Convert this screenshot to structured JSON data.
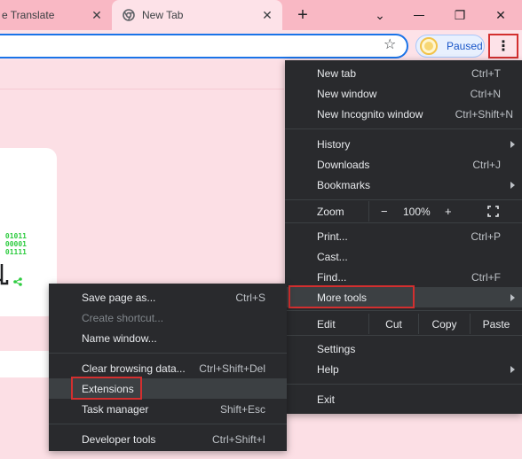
{
  "tabs": [
    {
      "title": "e Translate",
      "close": "✕",
      "icon": "translate-icon"
    },
    {
      "title": "New Tab",
      "close": "✕",
      "icon": "chrome-icon"
    }
  ],
  "new_tab_button": "+",
  "window_controls": {
    "dropdown": "⌄",
    "restore": "❐",
    "close": "✕"
  },
  "toolbar": {
    "bookmark_icon": "☆",
    "profile_label": "Paused",
    "menu_icon": "⋮"
  },
  "page": {
    "binary_lines": [
      "01011",
      "00001",
      "01111"
    ],
    "tool_icon": "┘"
  },
  "menu": {
    "new_tab": {
      "label": "New tab",
      "shortcut": "Ctrl+T"
    },
    "new_window": {
      "label": "New window",
      "shortcut": "Ctrl+N"
    },
    "new_incognito": {
      "label": "New Incognito window",
      "shortcut": "Ctrl+Shift+N"
    },
    "history": {
      "label": "History"
    },
    "downloads": {
      "label": "Downloads",
      "shortcut": "Ctrl+J"
    },
    "bookmarks": {
      "label": "Bookmarks"
    },
    "zoom": {
      "label": "Zoom",
      "minus": "−",
      "value": "100%",
      "plus": "+"
    },
    "print": {
      "label": "Print...",
      "shortcut": "Ctrl+P"
    },
    "cast": {
      "label": "Cast..."
    },
    "find": {
      "label": "Find...",
      "shortcut": "Ctrl+F"
    },
    "more_tools": {
      "label": "More tools"
    },
    "edit": {
      "label": "Edit",
      "cut": "Cut",
      "copy": "Copy",
      "paste": "Paste"
    },
    "settings": {
      "label": "Settings"
    },
    "help": {
      "label": "Help"
    },
    "exit": {
      "label": "Exit"
    }
  },
  "submenu": {
    "save_page": {
      "label": "Save page as...",
      "shortcut": "Ctrl+S"
    },
    "create_shortcut": {
      "label": "Create shortcut..."
    },
    "name_window": {
      "label": "Name window..."
    },
    "clear_data": {
      "label": "Clear browsing data...",
      "shortcut": "Ctrl+Shift+Del"
    },
    "extensions": {
      "label": "Extensions"
    },
    "task_manager": {
      "label": "Task manager",
      "shortcut": "Shift+Esc"
    },
    "dev_tools": {
      "label": "Developer tools",
      "shortcut": "Ctrl+Shift+I"
    }
  },
  "colors": {
    "menu_bg": "#292a2d",
    "highlight_box": "#d32f2f",
    "tabbar": "#f9b8c4",
    "page_bg": "#fcdfe5"
  }
}
